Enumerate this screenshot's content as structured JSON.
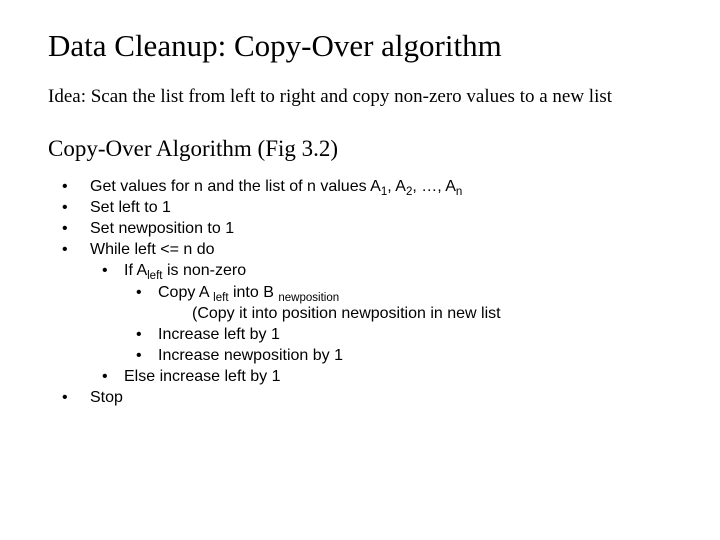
{
  "title": "Data Cleanup: Copy-Over algorithm",
  "idea": "Idea: Scan the list from left to right and copy non-zero values to a new list",
  "algoheader": "Copy-Over Algorithm (Fig 3.2)",
  "steps": {
    "s1a": "Get values for n and the list of n values A",
    "s1b": "1",
    "s1c": ", A",
    "s1d": "2",
    "s1e": ", …, A",
    "s1f": "n",
    "s2": "Set left to 1",
    "s3": "Set newposition to 1",
    "s4": "While left <= n do",
    "s4a_a": "If  A",
    "s4a_b": "left",
    "s4a_c": " is non-zero",
    "s4a1_a": "Copy A ",
    "s4a1_b": "left",
    "s4a1_c": " into B ",
    "s4a1_d": "newposition",
    "s4a1_cont": "(Copy it into position newposition in new list",
    "s4a2": "Increase left by 1",
    "s4a3": "Increase newposition by 1",
    "s4b": "Else increase left by 1",
    "s5": "Stop"
  }
}
